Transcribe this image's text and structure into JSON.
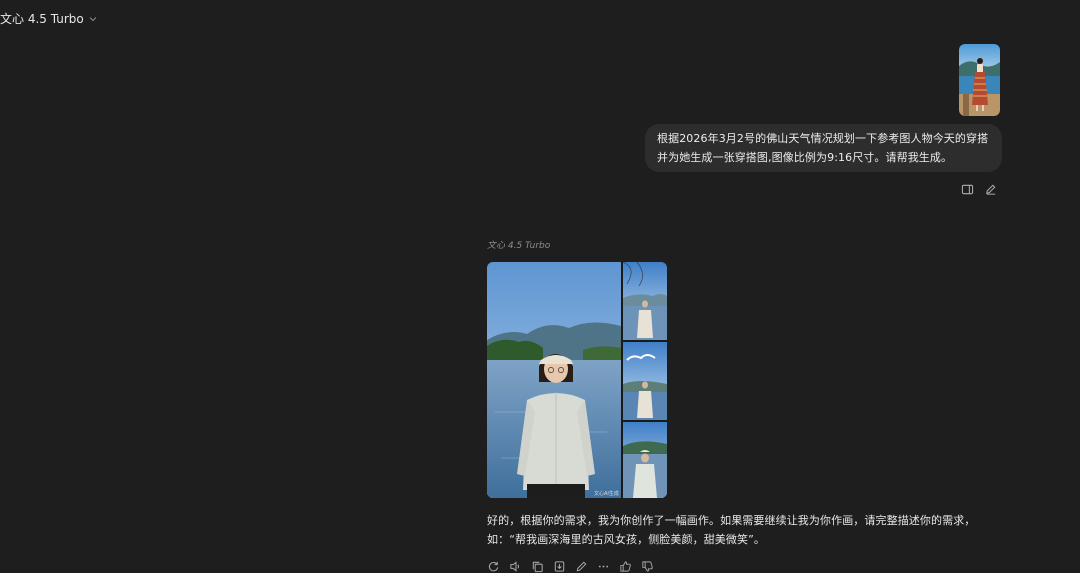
{
  "header": {
    "model_name": "文心 4.5 Turbo"
  },
  "conversation": {
    "user_message": {
      "text": "根据2026年3月2号的佛山天气情况规划一下参考图人物今天的穿搭并为她生成一张穿搭图,图像比例为9:16尺寸。请帮我生成。",
      "actions": [
        {
          "name": "panel-icon",
          "label": "open side panel"
        },
        {
          "name": "edit-icon",
          "label": "edit message"
        }
      ]
    },
    "assistant_message": {
      "model_tag": "文心 4.5 Turbo",
      "image_watermark": "文心AI生成",
      "text": "好的，根据你的需求，我为你创作了一幅画作。如果需要继续让我为你作画，请完整描述你的需求，如：“帮我画深海里的古风女孩，侧脸美颜，甜美微笑”。",
      "actions": [
        "refresh-icon",
        "speaker-icon",
        "copy-icon",
        "download-icon",
        "share-icon",
        "more-icon",
        "like-icon",
        "dislike-icon"
      ]
    }
  },
  "colors": {
    "background": "#1e1e1e",
    "bubble": "#2d2d2e",
    "text": "#e8e8e8",
    "muted": "#8d8d8d"
  }
}
